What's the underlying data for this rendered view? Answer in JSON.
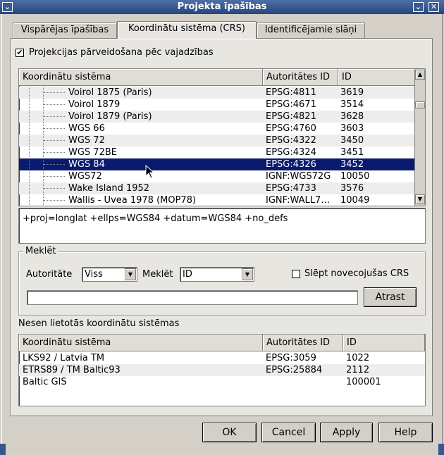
{
  "window": {
    "title": "Projekta īpašības"
  },
  "tabs": [
    {
      "label": "Vispārējas īpašības"
    },
    {
      "label": "Koordinātu sistēma (CRS)"
    },
    {
      "label": "Identificējamie slāņi"
    }
  ],
  "otf": {
    "label": "Projekcijas pārveidošana pēc vajadzības",
    "checked": "✔"
  },
  "crs_table": {
    "headers": [
      "Koordinātu sistēma",
      "Autoritātes ID",
      "ID"
    ],
    "rows": [
      {
        "name": "Voirol 1875 (Paris)",
        "auth": "EPSG:4811",
        "id": "3619"
      },
      {
        "name": "Voirol 1879",
        "auth": "EPSG:4671",
        "id": "3514"
      },
      {
        "name": "Voirol 1879 (Paris)",
        "auth": "EPSG:4821",
        "id": "3628"
      },
      {
        "name": "WGS 66",
        "auth": "EPSG:4760",
        "id": "3603"
      },
      {
        "name": "WGS 72",
        "auth": "EPSG:4322",
        "id": "3450"
      },
      {
        "name": "WGS 72BE",
        "auth": "EPSG:4324",
        "id": "3451"
      },
      {
        "name": "WGS 84",
        "auth": "EPSG:4326",
        "id": "3452"
      },
      {
        "name": "WGS72",
        "auth": "IGNF:WGS72G",
        "id": "10050"
      },
      {
        "name": "Wake Island 1952",
        "auth": "EPSG:4733",
        "id": "3576"
      },
      {
        "name": "Wallis - Uvea 1978 (MOP78)",
        "auth": "IGNF:WALL7…",
        "id": "10049"
      }
    ],
    "selected_index": 6
  },
  "proj_string": "+proj=longlat +ellps=WGS84 +datum=WGS84 +no_defs",
  "search": {
    "group_label": "Meklēt",
    "authority_label": "Autoritāte",
    "authority_value": "Viss",
    "search_label": "Meklēt",
    "search_value": "ID",
    "hide_deprecated_label": "Slēpt novecojušas CRS",
    "input_value": "",
    "find_button": "Atrast"
  },
  "recent": {
    "label": "Nesen lietotās koordinātu sistēmas",
    "headers": [
      "Koordinātu sistēma",
      "Autoritātes ID",
      "ID"
    ],
    "rows": [
      {
        "name": "LKS92 / Latvia TM",
        "auth": "EPSG:3059",
        "id": "1022"
      },
      {
        "name": "ETRS89 / TM Baltic93",
        "auth": "EPSG:25884",
        "id": "2112"
      },
      {
        "name": "Baltic GIS",
        "auth": "",
        "id": "100001"
      }
    ]
  },
  "buttons": {
    "ok": "OK",
    "cancel": "Cancel",
    "apply": "Apply",
    "help": "Help"
  },
  "colors": {
    "selection": "#0a1a6e",
    "titlebar": "#36578e"
  }
}
